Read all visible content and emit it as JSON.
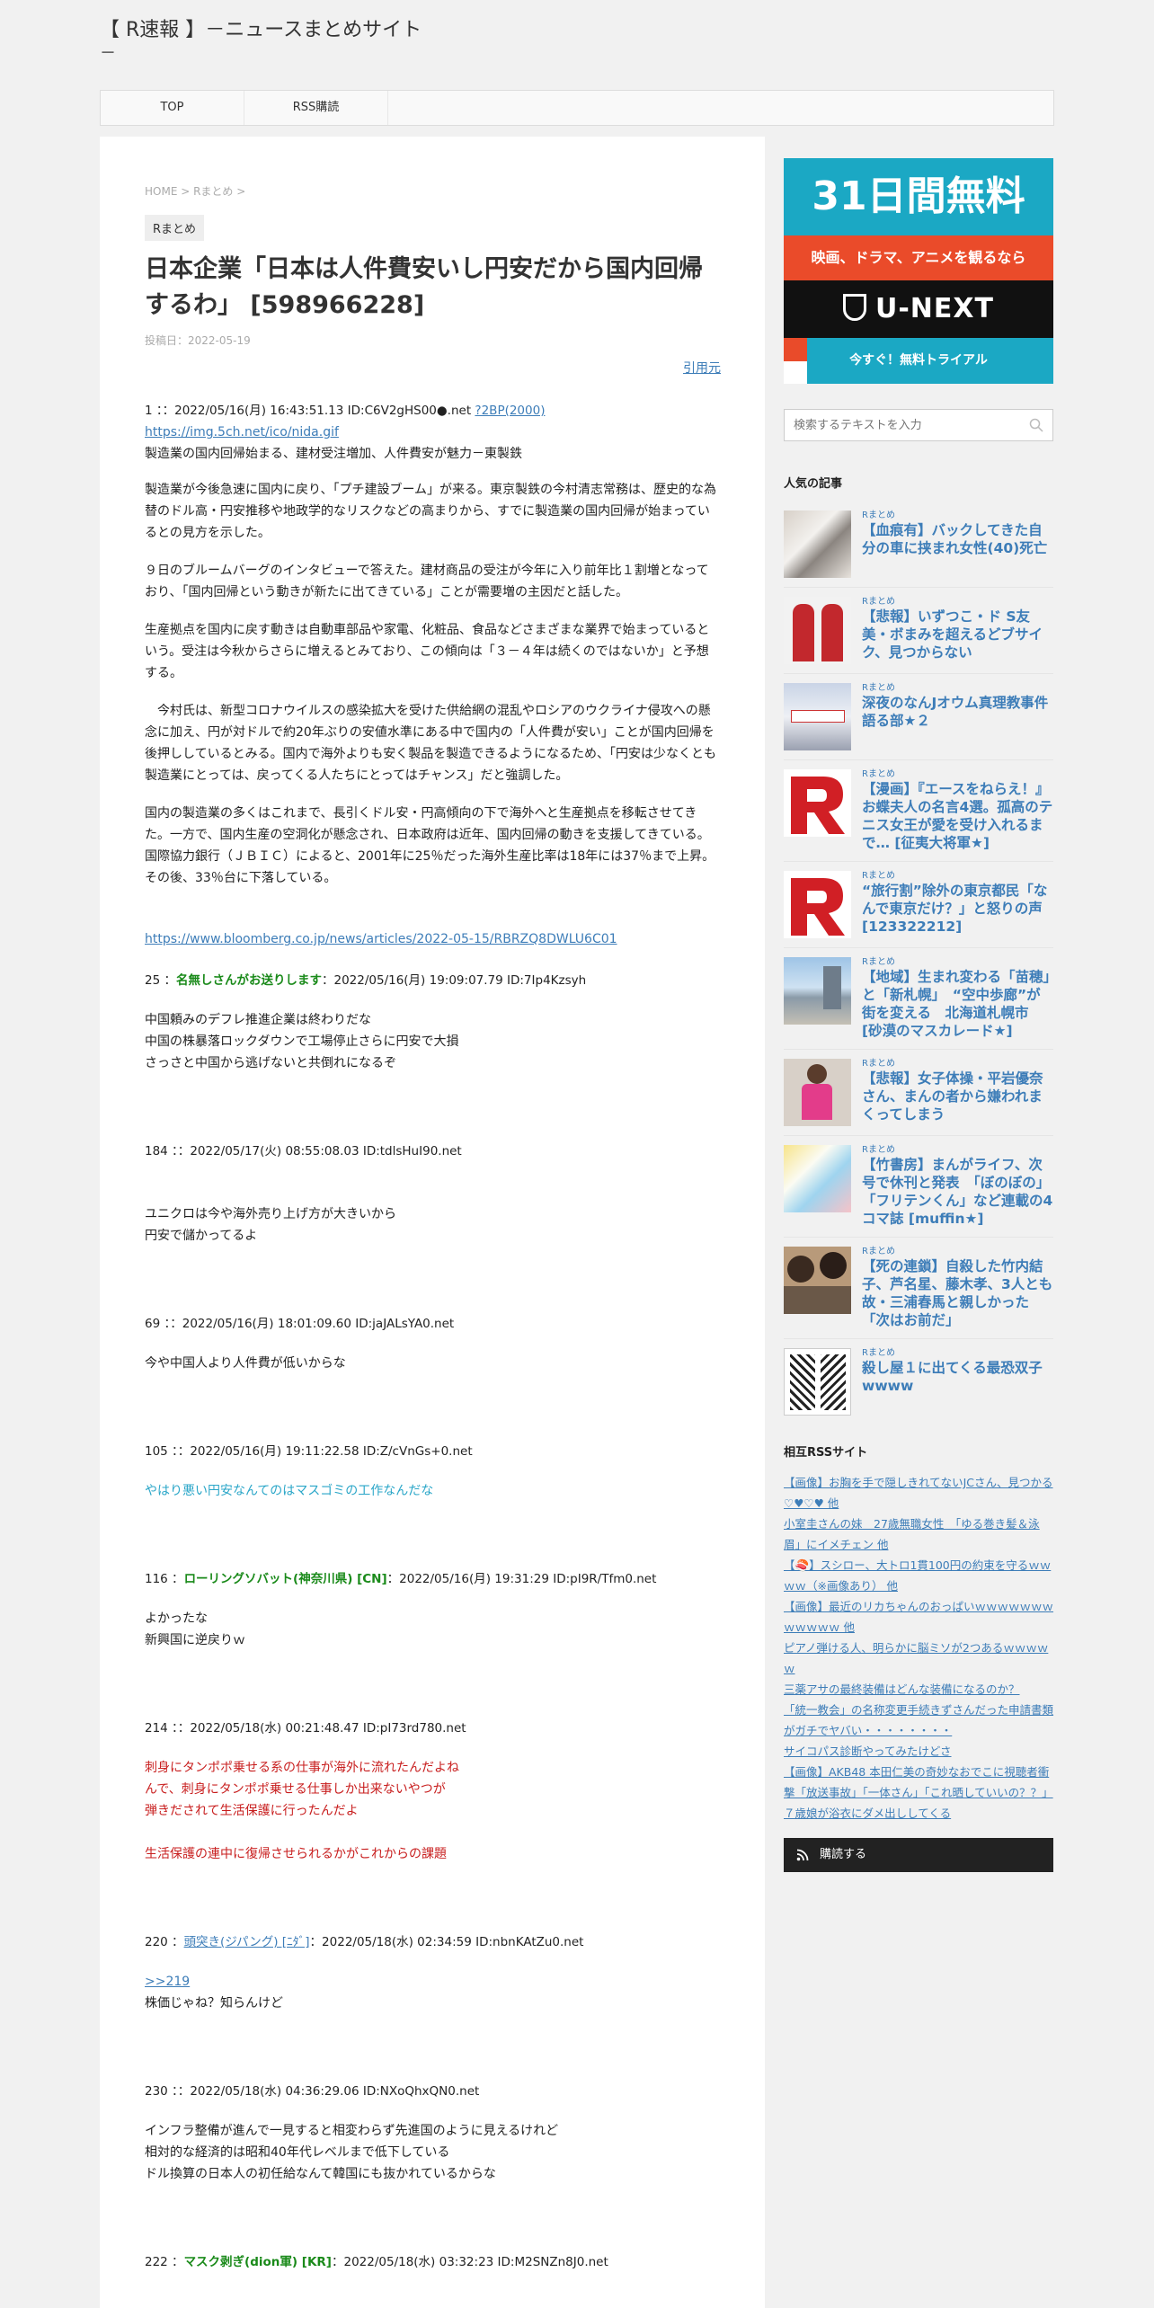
{
  "site": {
    "title": "【 R速報 】－ニュースまとめサイト",
    "title_cont": "－"
  },
  "nav": {
    "items": [
      "TOP",
      "RSS購読"
    ]
  },
  "article": {
    "breadcrumb": "HOME > Rまとめ >",
    "category": "Rまとめ",
    "title": "日本企業「日本は人件費安いし円安だから国内回帰するわ」 [598966228]",
    "date": "投稿日：2022-05-19",
    "source_link": "引用元",
    "op": {
      "head": "1 ：：2022/05/16(月) 16:43:51.13 ID:C6V2gHS00●.net",
      "head_link": "?2BP(2000)",
      "image_link": "https://img.5ch.net/ico/nida.gif",
      "lead": "製造業の国内回帰始まる、建材受注増加、人件費安が魅力－東製鉄",
      "p1": "製造業が今後急速に国内に戻り、「プチ建設ブーム」が来る。東京製鉄の今村清志常務は、歴史的な為替のドル高・円安推移や地政学的なリスクなどの高まりから、すでに製造業の国内回帰が始まっているとの見方を示した。",
      "p2": "９日のブルームバーグのインタビューで答えた。建材商品の受注が今年に入り前年比１割増となっており、「国内回帰という動きが新たに出てきている」ことが需要増の主因だと話した。",
      "p3": "生産拠点を国内に戻す動きは自動車部品や家電、化粧品、食品などさまざまな業界で始まっているという。受注は今秋からさらに増えるとみており、この傾向は「３－４年は続くのではないか」と予想する。",
      "p4": "　今村氏は、新型コロナウイルスの感染拡大を受けた供給網の混乱やロシアのウクライナ侵攻への懸念に加え、円が対ドルで約20年ぶりの安値水準にある中で国内の「人件費が安い」ことが国内回帰を後押ししているとみる。国内で海外よりも安く製品を製造できるようになるため、「円安は少なくとも製造業にとっては、戻ってくる人たちにとってはチャンス」だと強調した。",
      "p5": "国内の製造業の多くはこれまで、長引くドル安・円高傾向の下で海外へと生産拠点を移転させてきた。一方で、国内生産の空洞化が懸念され、日本政府は近年、国内回帰の動きを支援してきている。国際協力銀行（ＪＢＩＣ）によると、2001年に25％だった海外生産比率は18年には37％まで上昇。その後、33％台に下落している。",
      "url": "https://www.bloomberg.co.jp/news/articles/2022-05-15/RBRZQ8DWLU6C01"
    },
    "replies": [
      {
        "num": "25 ：",
        "name": "名無しさんがお送りします",
        "meta": "：2022/05/16(月) 19:09:07.79 ID:7Ip4Kzsyh",
        "lines": [
          "中国頼みのデフレ推進企業は終わりだな",
          "中国の株暴落ロックダウンで工場停止さらに円安で大損",
          "さっさと中国から逃げないと共倒れになるぞ"
        ]
      },
      {
        "num": "184 ：：",
        "meta": "2022/05/17(火) 08:55:08.03 ID:tdlsHuI90.net",
        "lines": [
          "ユニクロは今や海外売り上げ方が大きいから",
          "円安で儲かってるよ"
        ]
      },
      {
        "num": "69 ：：",
        "meta": "2022/05/16(月) 18:01:09.60 ID:jaJALsYA0.net",
        "lines": [
          "今や中国人より人件費が低いからな"
        ]
      },
      {
        "num": "105 ：：",
        "meta": "2022/05/16(月) 19:11:22.58 ID:Z/cVnGs+0.net",
        "lines": [
          "やはり悪い円安なんてのはマスゴミの工作なんだな"
        ]
      },
      {
        "num": "116 ：",
        "name": "ローリングソバット(神奈川県) [CN]",
        "meta": "：2022/05/16(月) 19:31:29 ID:pI9R/Tfm0.net",
        "lines": [
          "よかったな",
          "新興国に逆戻りｗ"
        ]
      },
      {
        "num": "214 ：：",
        "meta": "2022/05/18(水) 00:21:48.47 ID:pI73rd780.net",
        "lines": [
          "刺身にタンポポ乗せる系の仕事が海外に流れたんだよね",
          "んで、刺身にタンポポ乗せる仕事しか出来ないやつが",
          "弾きだされて生活保護に行ったんだよ"
        ],
        "extra": "生活保護の連中に復帰させられるかがこれからの課題"
      },
      {
        "num": "220 ：",
        "name": "頭突き(ジパング) [ﾆﾀﾞ]",
        "meta": "：2022/05/18(水) 02:34:59 ID:nbnKAtZu0.net",
        "anchor": ">>219",
        "lines": [
          "株価じゃね？知らんけど"
        ]
      },
      {
        "num": "230 ：：",
        "meta": "2022/05/18(水) 04:36:29.06 ID:NXoQhxQN0.net",
        "lines": [
          "インフラ整備が進んで一見すると相変わらず先進国のように見えるけれど",
          "相対的な経済的は昭和40年代レベルまで低下している",
          "ドル換算の日本人の初任給なんて韓国にも抜かれているからな"
        ]
      },
      {
        "num": "222 ：",
        "name": "マスク剥ぎ(dion軍) [KR]",
        "meta": "：2022/05/18(水) 03:32:23 ID:M2SNZn8J0.net"
      }
    ]
  },
  "sidebar": {
    "ad": {
      "headline": "31日間無料",
      "sub": "映画、ドラマ、アニメを観るなら",
      "logo": "U-NEXT",
      "cta": "今すぐ！無料トライアル"
    },
    "search_placeholder": "検索するテキストを入力",
    "popular_title": "人気の記事",
    "popular": [
      {
        "cat": "Rまとめ",
        "title": "【血痕有】バックしてきた自分の車に挟まれ女性(40)死亡"
      },
      {
        "cat": "Rまとめ",
        "title": "【悲報】いずつこ・ド S友美・ボまみを超えるどブサイク、見つからない"
      },
      {
        "cat": "Rまとめ",
        "title": "深夜のなんJオウム真理教事件語る部★２"
      },
      {
        "cat": "Rまとめ",
        "title": "【漫画】『エースをねらえ！』お蝶夫人の名言4選。孤高のテニス女王が愛を受け入れるまで… [征夷大将軍★]"
      },
      {
        "cat": "Rまとめ",
        "title": "“旅行割”除外の東京都民「なんで東京だけ？」と怒りの声 [123322212]"
      },
      {
        "cat": "Rまとめ",
        "title": "【地域】生まれ変わる「苗穂」と「新札幌」　“空中歩廊”が街を変える　北海道札幌市 [砂漠のマスカレード★]"
      },
      {
        "cat": "Rまとめ",
        "title": "【悲報】女子体操・平岩優奈さん、まんの者から嫌われまくってしまう"
      },
      {
        "cat": "Rまとめ",
        "title": "【竹書房】まんがライフ、次号で休刊と発表　「ぼのぼの」「フリテンくん」など連載の4コマ誌 [muffin★]"
      },
      {
        "cat": "Rまとめ",
        "title": "【死の連鎖】自殺した竹内結子、芦名星、藤木孝、3人とも故・三浦春馬と親しかった「次はお前だ」"
      },
      {
        "cat": "Rまとめ",
        "title": "殺し屋１に出てくる最恐双子wwww"
      }
    ],
    "rss_title": "相互RSSサイト",
    "rss": [
      "【画像】お胸を手で隠しきれてないJCさん、見つかる♡♥♡♥ 他",
      "小室圭さんの妹　27歳無職女性　「ゆる巻き髪＆泳眉」にイメチェン 他",
      "【🍣】スシロー、大トロ1貫100円の約束を守るｗｗｗｗ（※画像あり） 他",
      "【画像】最近のリカちゃんのおっぱいｗｗｗｗｗｗｗｗｗｗｗｗ 他",
      "ピアノ弾ける人、明らかに脳ミソが2つあるｗｗｗｗｗ",
      "三薬アサの最終装備はどんな装備になるのか？",
      "「統一教会」の名称変更手続きずさんだった申請書類がガチでヤバい・・・・・・・・",
      "サイコパス診断やってみたけどさ",
      "【画像】AKB48 本田仁美の奇妙なおでこに視聴者衝撃「放送事故」「一体さん」「これ晒していいの？？」",
      "７歳娘が浴衣にダメ出ししてくる"
    ],
    "rss_button": "購読する"
  }
}
